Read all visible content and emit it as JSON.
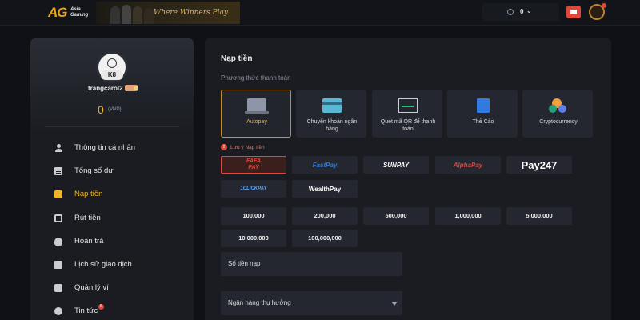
{
  "header": {
    "logo_mark": "AG",
    "logo_name": "Asia Gaming",
    "banner_tagline": "Where Winners Play",
    "wallet_balance": "0",
    "wallet_chevron": "⌄"
  },
  "sidebar": {
    "avatar_level": "K8",
    "username": "trangcarol2",
    "balance": "0",
    "currency": "(VND)",
    "news_count": "5",
    "items": [
      {
        "label": "Thông tin cá nhân",
        "icon": "user-icon"
      },
      {
        "label": "Tổng số dư",
        "icon": "clipboard-icon"
      },
      {
        "label": "Nạp tiền",
        "icon": "deposit-icon",
        "active": true
      },
      {
        "label": "Rút tiền",
        "icon": "withdraw-icon"
      },
      {
        "label": "Hoàn trả",
        "icon": "refund-icon"
      },
      {
        "label": "Lịch sử giao dịch",
        "icon": "history-icon"
      },
      {
        "label": "Quản lý ví",
        "icon": "wallet-icon"
      },
      {
        "label": "Tin tức",
        "icon": "chat-icon"
      }
    ]
  },
  "main": {
    "title": "Nạp tiền",
    "methods_label": "Phương thức thanh toán",
    "methods": [
      {
        "label": "Autopay",
        "icon": "laptop-icon",
        "selected": true
      },
      {
        "label": "Chuyển khoản ngân hàng",
        "icon": "bank-card-icon"
      },
      {
        "label": "Quét mã QR để thanh toán",
        "icon": "qr-scan-icon"
      },
      {
        "label": "Thẻ Cào",
        "icon": "phone-card-icon"
      },
      {
        "label": "Cryptocurrency",
        "icon": "crypto-icon"
      }
    ],
    "note": "Lưu ý Nạp tiền",
    "providers": [
      {
        "label": "FAFA PAY",
        "color": "#e0463a"
      },
      {
        "label": "FastPay",
        "color": "#2f7be0"
      },
      {
        "label": "SUNPAY",
        "color": "#ffffff"
      },
      {
        "label": "AlphaPay",
        "color": "#e0463a"
      },
      {
        "label": "Pay247",
        "color": "#ffffff"
      },
      {
        "label": "1CLICKPAY",
        "color": "#5aa7ff"
      },
      {
        "label": "WealthPay",
        "color": "#ffffff"
      }
    ],
    "amounts": [
      "100,000",
      "200,000",
      "500,000",
      "1,000,000",
      "5,000,000",
      "10,000,000",
      "100,000,000"
    ],
    "amount_field_label": "Số tiền nạp",
    "bank_field_label": "Ngân hàng thụ hưởng"
  },
  "colors": {
    "accent": "#f0b429",
    "background": "#0f1116",
    "panel": "#1a1c22",
    "tile": "#24272f",
    "alert": "#e0463a"
  }
}
